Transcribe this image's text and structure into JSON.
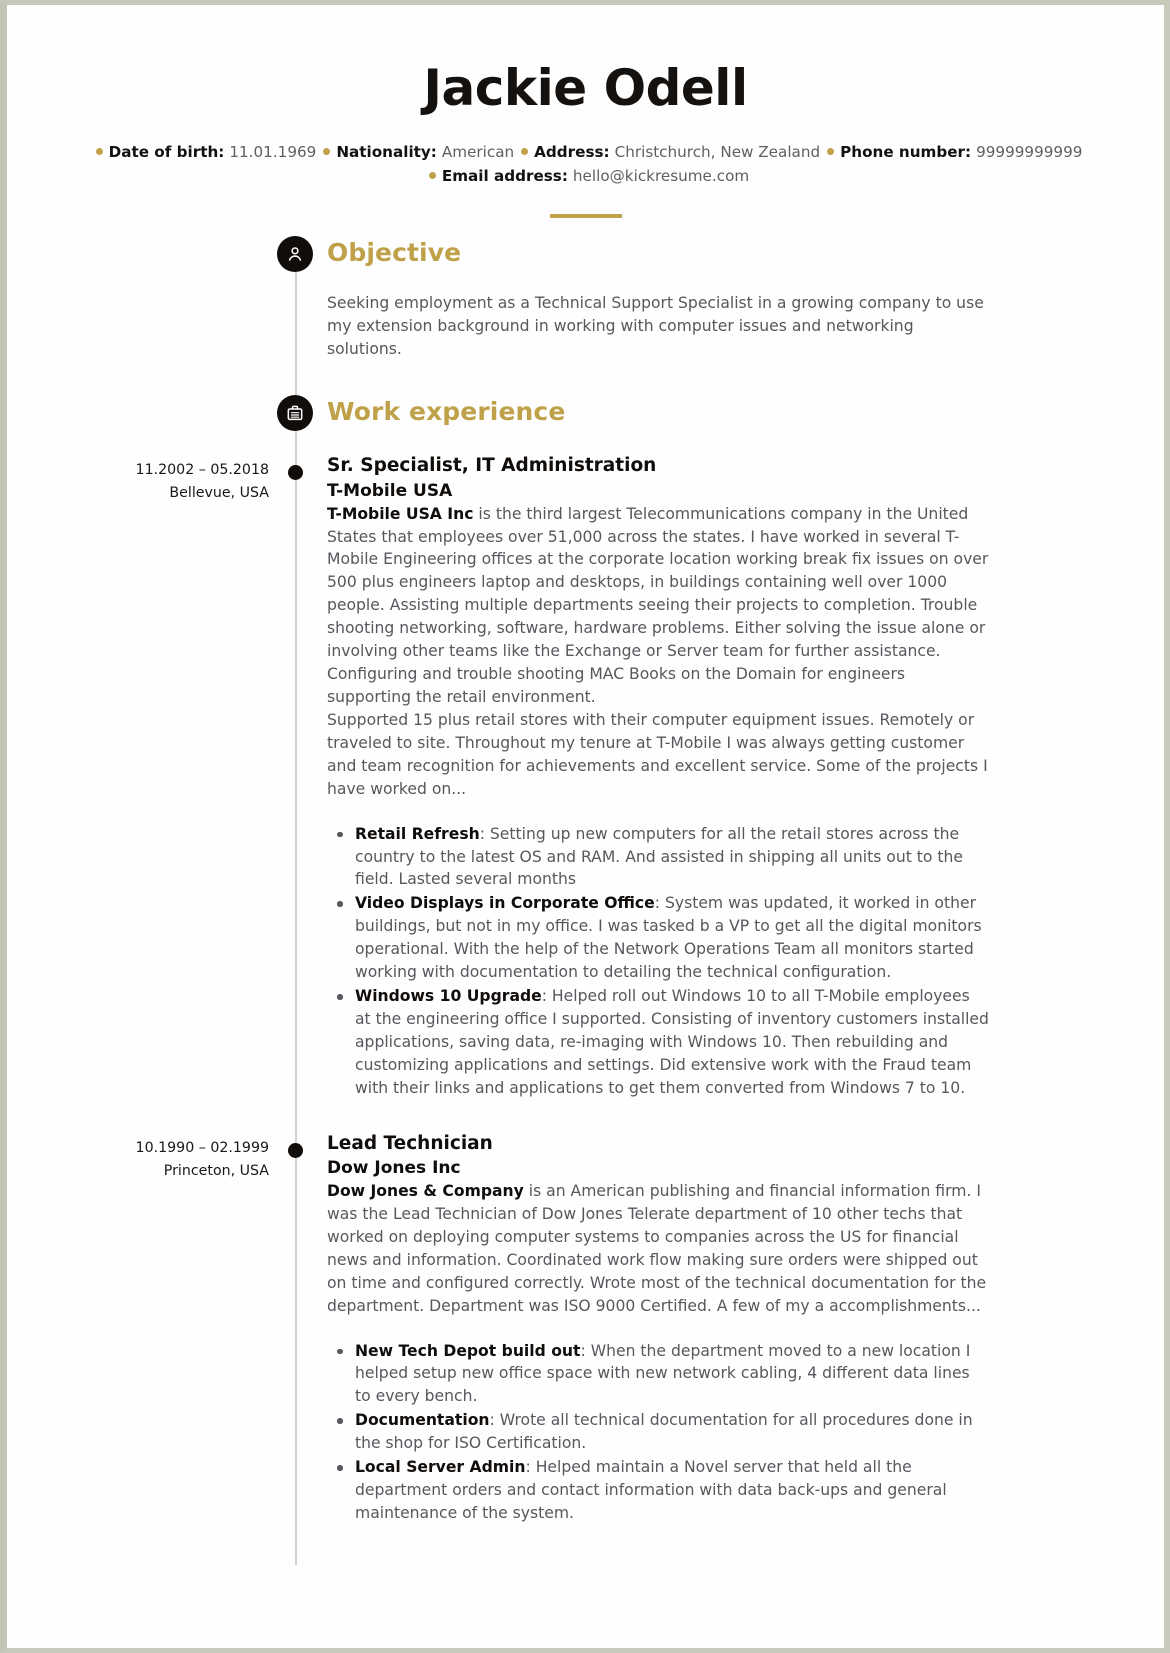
{
  "header": {
    "name": "Jackie Odell",
    "contacts_line1": [
      {
        "label": "Date of birth:",
        "value": "11.01.1969"
      },
      {
        "label": "Nationality:",
        "value": "American"
      },
      {
        "label": "Address:",
        "value": "Christchurch, New Zealand"
      },
      {
        "label": "Phone number:",
        "value": "99999999999"
      }
    ],
    "contacts_line2": [
      {
        "label": "Email address:",
        "value": "hello@kickresume.com"
      }
    ]
  },
  "colors": {
    "accent_gold": "#bfa14a",
    "icon_circle": "#100d0b",
    "body_text": "#55585c",
    "heading_text": "#100d0b",
    "page_border": "#c7c8b9",
    "timeline_line": "#d2d2d2"
  },
  "sections": [
    {
      "id": "objective",
      "icon": "person-icon",
      "title": "Objective",
      "text": "Seeking employment as a Technical Support Specialist in a growing company to use my extension background in working with computer issues and networking solutions."
    },
    {
      "id": "work-experience",
      "icon": "briefcase-icon",
      "title": "Work experience"
    }
  ],
  "jobs": [
    {
      "dates": "11.2002 – 05.2018",
      "location": "Bellevue, USA",
      "title": "Sr. Specialist, IT Administration",
      "company": "T-Mobile USA",
      "desc_lead": "T-Mobile USA Inc",
      "desc_rest": " is the third largest Telecommunications company in the United States that employees over 51,000 across the states. I have worked in several T-Mobile Engineering offices at the corporate location working break fix issues on over 500 plus engineers laptop and desktops, in buildings containing well over 1000 people. Assisting multiple departments seeing their projects to completion. Trouble shooting networking, software, hardware problems. Either solving the issue alone or involving other teams like the Exchange or Server team for further assistance.",
      "desc_extra": [
        "Configuring and trouble shooting MAC Books on the Domain for engineers supporting the retail environment.",
        "Supported 15 plus retail stores with their computer equipment issues. Remotely or traveled to site. Throughout my tenure at T-Mobile I was always getting customer and team recognition for achievements and excellent service. Some of the projects I have worked on..."
      ],
      "bullets": [
        {
          "lead": "Retail Refresh",
          "rest": ": Setting up new computers for all the retail stores across the country to the latest OS and RAM. And assisted in shipping all units out to the field. Lasted several months"
        },
        {
          "lead": "Video Displays in Corporate Office",
          "rest": ": System was updated, it worked in other buildings, but not in my office. I was tasked b a VP to get all the digital monitors operational. With the help of the Network Operations Team all monitors started working with documentation to  detailing the technical configuration."
        },
        {
          "lead": "Windows 10 Upgrade",
          "rest": ": Helped roll out Windows 10 to all T-Mobile employees at the engineering office I supported. Consisting of inventory customers installed applications, saving data, re-imaging with Windows 10. Then rebuilding and customizing applications and settings. Did extensive work with the Fraud team with their links and applications to get them converted from Windows 7 to 10."
        }
      ]
    },
    {
      "dates": "10.1990 – 02.1999",
      "location": "Princeton, USA",
      "title": "Lead Technician",
      "company": "Dow Jones Inc",
      "desc_lead": "Dow Jones & Company",
      "desc_rest": " is an American publishing and financial information firm. I was the Lead Technician of Dow Jones Telerate department of 10 other techs that worked on deploying computer systems to companies  across the US for financial news and information. Coordinated work flow making sure orders were shipped out on time and configured correctly. Wrote most of the technical documentation for the department. Department was ISO 9000 Certified. A few of my a accomplishments...",
      "desc_extra": [],
      "bullets": [
        {
          "lead": "New Tech Depot build out",
          "rest": ": When the department moved to a new location I helped setup new office space with new network cabling, 4 different data lines to every bench."
        },
        {
          "lead": "Documentation",
          "rest": ": Wrote all technical documentation for all procedures done in the shop for ISO Certification."
        },
        {
          "lead": "Local Server Admin",
          "rest": ": Helped maintain a Novel server that held all the department orders and contact information with data back-ups and general maintenance of the system."
        }
      ]
    }
  ]
}
